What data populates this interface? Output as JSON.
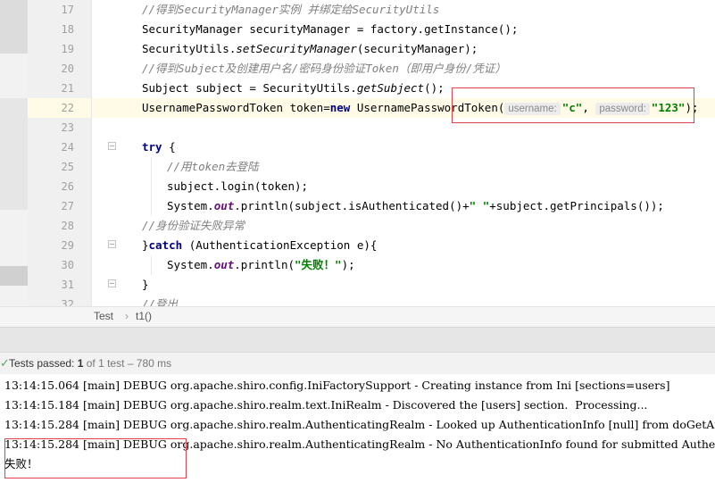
{
  "editor": {
    "line_numbers": [
      "17",
      "18",
      "19",
      "20",
      "21",
      "22",
      "23",
      "24",
      "25",
      "26",
      "27",
      "28",
      "29",
      "30",
      "31",
      "32"
    ],
    "lines": {
      "l17": "//得到SecurityManager实例 并绑定给SecurityUtils",
      "l18": "SecurityManager securityManager = factory.getInstance();",
      "l19a": "SecurityUtils.",
      "l19b": "setSecurityManager",
      "l19c": "(securityManager);",
      "l20": "//得到Subject及创建用户名/密码身份验证Token（即用户身份/凭证）",
      "l21a": "Subject subject = SecurityUtils.",
      "l21b": "getSubject",
      "l21c": "();",
      "l22a": "UsernamePasswordToken token=",
      "l22kw": "new",
      "l22b": " UsernamePasswordToken(",
      "l22hint1": "username:",
      "l22s1": "\"c\"",
      "l22comma": ", ",
      "l22hint2": "password:",
      "l22s2": "\"123\"",
      "l22c": ");",
      "l24kw": "try",
      "l24b": " {",
      "l25": "//用token去登陆",
      "l26": "subject.login(token);",
      "l27a": "System.",
      "l27fld": "out",
      "l27b": ".println(subject.isAuthenticated()+",
      "l27s": "\" \"",
      "l27c": "+subject.getPrincipals());",
      "l28": "//身份验证失败异常",
      "l29a": "}",
      "l29kw": "catch",
      "l29b": " (AuthenticationException e){",
      "l30a": "System.",
      "l30fld": "out",
      "l30b": ".println(",
      "l30s": "\"失败！\"",
      "l30c": ");",
      "l31": "}",
      "l32": "//登出"
    }
  },
  "breadcrumbs": {
    "class": "Test",
    "separator": "›",
    "method": "t1()"
  },
  "test_status": {
    "check_icon": "check-icon",
    "prefix": "Tests passed: ",
    "passed": "1",
    "suffix": " of 1 test – 780 ms"
  },
  "console": {
    "lines": [
      "13:14:15.064 [main] DEBUG org.apache.shiro.config.IniFactorySupport - Creating instance from Ini [sections=users]",
      "13:14:15.184 [main] DEBUG org.apache.shiro.realm.text.IniRealm - Discovered the [users] section.  Processing...",
      "13:14:15.284 [main] DEBUG org.apache.shiro.realm.AuthenticatingRealm - Looked up AuthenticationInfo [null] from doGetAuthenticationInfo",
      "13:14:15.284 [main] DEBUG org.apache.shiro.realm.AuthenticatingRealm - No AuthenticationInfo found for submitted AuthenticationToken",
      "失败！"
    ]
  },
  "colors": {
    "highlight_box": "#e0414b",
    "string": "#008000",
    "keyword": "#000080",
    "comment": "#808080"
  }
}
